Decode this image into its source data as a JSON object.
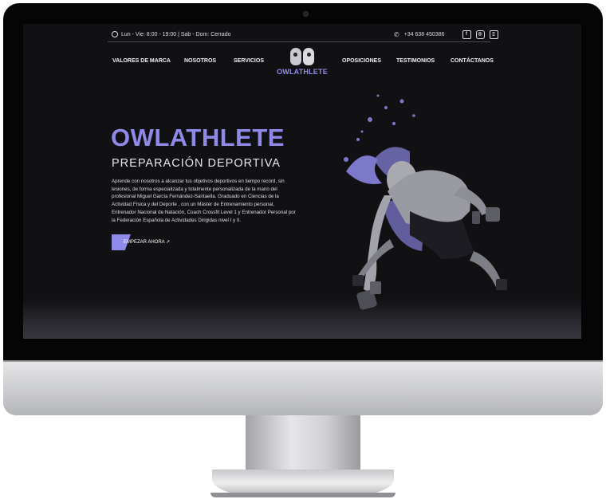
{
  "topbar": {
    "hours": "Lun - Vie: 8:00 - 19:00 | Sab - Dom: Cerrado",
    "phone": "+34 638 450386",
    "icons": [
      "clock-icon",
      "phone-icon",
      "facebook-icon",
      "instagram-icon",
      "twitch-icon"
    ]
  },
  "nav": {
    "items": [
      "VALORES DE MARCA",
      "NOSOTROS",
      "SERVICIOS",
      "OPOSICIONES",
      "TESTIMONIOS",
      "CONTÁCTANOS"
    ],
    "logo_text": "OWLATHLETE"
  },
  "hero": {
    "title": "OWLATHLETE",
    "subtitle": "PREPARACIÓN DEPORTIVA",
    "description": "Aprende con nosotros a alcanzar tus objetivos deportivos en tiempo record, sin lesiones, de forma especializada y totalmente personalizada de la mano del profesional Miguel García Fernández-Santaella. Graduado en Ciencias de la Actividad Física y del Deporte , con un Máster de Entrenamiento personal, Entrenador Nacional de Natación, Coach Crossfit Level 1 y Entrenador Personal por la Federación Española de Actividades Dirigidas nivel I y II.",
    "cta": "EMPEZAR AHORA ↗"
  },
  "colors": {
    "accent": "#8f8aea",
    "background": "#111114"
  }
}
